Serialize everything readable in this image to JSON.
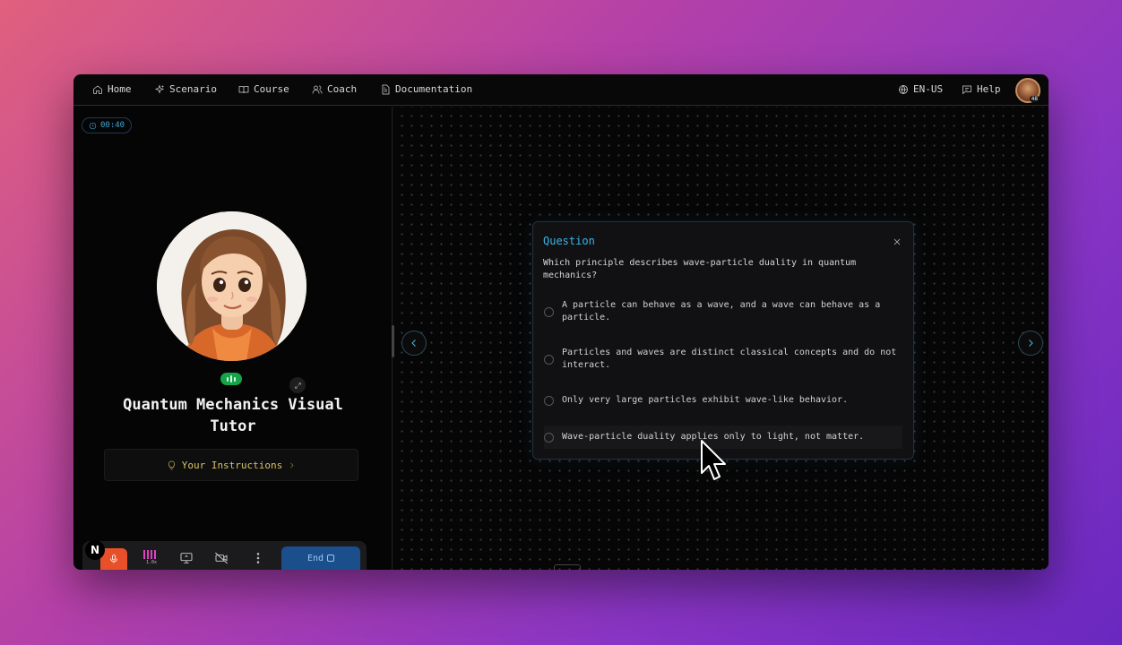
{
  "nav": {
    "items": [
      {
        "label": "Home",
        "icon": "home-icon"
      },
      {
        "label": "Scenario",
        "icon": "sparkle-icon"
      },
      {
        "label": "Course",
        "icon": "book-icon"
      },
      {
        "label": "Coach",
        "icon": "users-icon"
      },
      {
        "label": "Documentation",
        "icon": "document-icon"
      }
    ],
    "language": "EN-US",
    "help": "Help",
    "avatar_badge": "48"
  },
  "left": {
    "timer": "00:40",
    "tutor_title": "Quantum Mechanics Visual Tutor",
    "instructions_label": "Your Instructions",
    "controls": {
      "speed_label": "1.0x",
      "end_label": "End",
      "n_badge": "N"
    }
  },
  "question": {
    "title": "Question",
    "text": "Which principle describes wave-particle duality in quantum mechanics?",
    "options": [
      {
        "text": "A particle can behave as a wave, and a wave can behave as a particle."
      },
      {
        "text": "Particles and waves are distinct classical concepts and do not interact."
      },
      {
        "text": "Only very large particles exhibit wave-like behavior."
      },
      {
        "text": "Wave-particle duality applies only to light, not matter."
      }
    ]
  },
  "colors": {
    "accent": "#3cb4e6",
    "mic": "#e8502a",
    "end_button": "#1a4f8c",
    "instructions_text": "#d6c46a"
  }
}
